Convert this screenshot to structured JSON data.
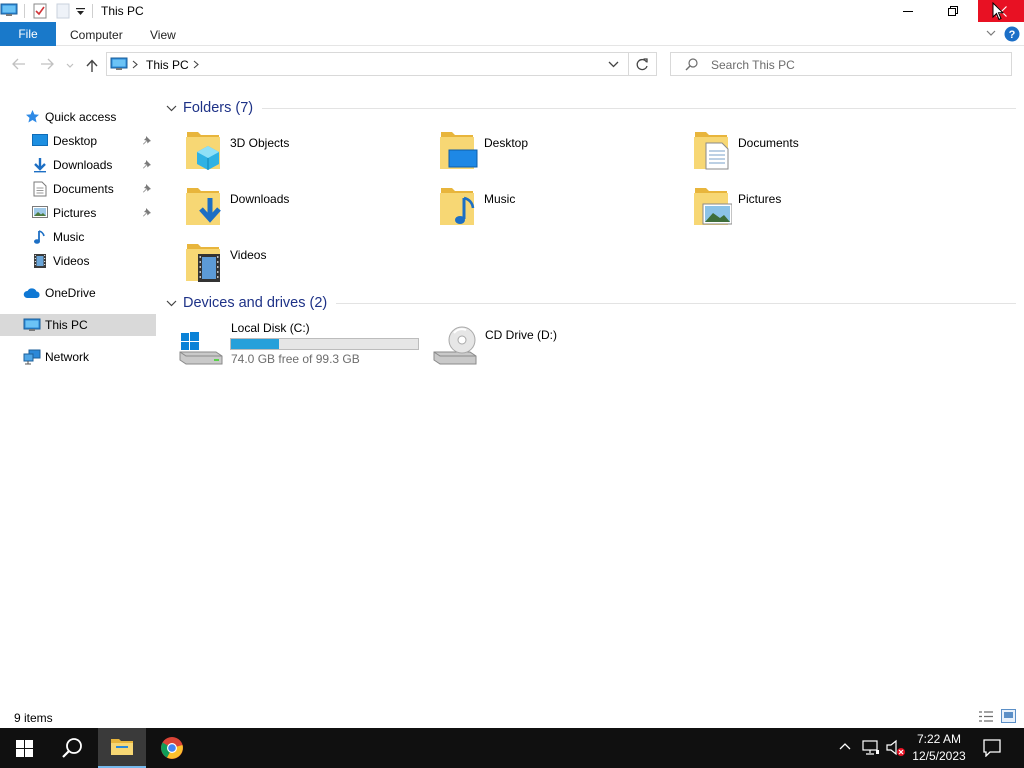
{
  "window": {
    "title": "This PC",
    "close_color": "#e81123"
  },
  "ribbon": {
    "file_label": "File",
    "tabs": [
      "Computer",
      "View"
    ],
    "accent": "#1979ca"
  },
  "address": {
    "path": [
      "This PC"
    ],
    "search_placeholder": "Search This PC"
  },
  "nav": {
    "quick_access": "Quick access",
    "pinned": [
      {
        "label": "Desktop",
        "icon": "desktop-icon",
        "pinned": true
      },
      {
        "label": "Downloads",
        "icon": "downloads-icon",
        "pinned": true
      },
      {
        "label": "Documents",
        "icon": "documents-icon",
        "pinned": true
      },
      {
        "label": "Pictures",
        "icon": "pictures-icon",
        "pinned": true
      },
      {
        "label": "Music",
        "icon": "music-icon",
        "pinned": false
      },
      {
        "label": "Videos",
        "icon": "videos-icon",
        "pinned": false
      }
    ],
    "onedrive": "OneDrive",
    "this_pc": "This PC",
    "network": "Network"
  },
  "content": {
    "folders_header": "Folders (7)",
    "folders": [
      {
        "label": "3D Objects",
        "icon": "3d-objects-folder-icon"
      },
      {
        "label": "Desktop",
        "icon": "desktop-folder-icon"
      },
      {
        "label": "Documents",
        "icon": "documents-folder-icon"
      },
      {
        "label": "Downloads",
        "icon": "downloads-folder-icon"
      },
      {
        "label": "Music",
        "icon": "music-folder-icon"
      },
      {
        "label": "Pictures",
        "icon": "pictures-folder-icon"
      },
      {
        "label": "Videos",
        "icon": "videos-folder-icon"
      }
    ],
    "drives_header": "Devices and drives (2)",
    "drives": [
      {
        "label": "Local Disk (C:)",
        "free_text": "74.0 GB free of 99.3 GB",
        "used_fraction": 0.255,
        "icon": "local-disk-icon"
      },
      {
        "label": "CD Drive (D:)",
        "icon": "cd-drive-icon"
      }
    ]
  },
  "status": {
    "items_text": "9 items"
  },
  "taskbar": {
    "time": "7:22 AM",
    "date": "12/5/2023"
  }
}
